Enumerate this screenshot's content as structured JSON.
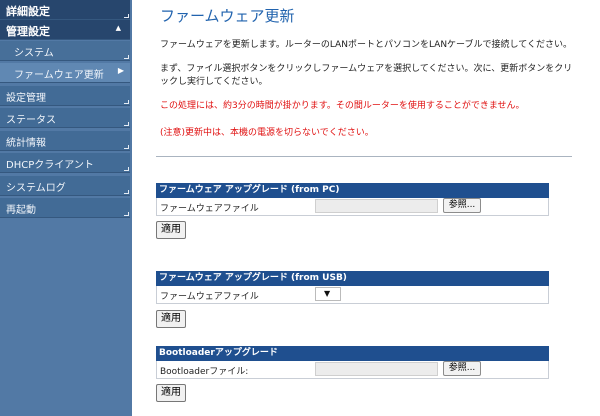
{
  "sidebar": {
    "top": "詳細設定",
    "group": "管理設定",
    "sub": [
      {
        "label": "システム"
      },
      {
        "label": "ファームウェア更新"
      },
      {
        "label": "設定管理"
      },
      {
        "label": "ステータス"
      },
      {
        "label": "統計情報"
      },
      {
        "label": "DHCPクライアント"
      },
      {
        "label": "システムログ"
      },
      {
        "label": "再起動"
      }
    ]
  },
  "main": {
    "title": "ファームウェア更新",
    "desc1": "ファームウェアを更新します。ルーターのLANポートとパソコンをLANケーブルで接続してください。",
    "desc2": "まず、ファイル選択ボタンをクリックしファームウェアを選択してください。次に、更新ボタンをクリックし実行してください。",
    "warn1": "この処理には、約3分の時間が掛かります。その間ルーターを使用することができません。",
    "warn2": "(注意)更新中は、本機の電源を切らないでください。"
  },
  "sections": {
    "pc": {
      "header": "ファームウェア アップグレード (from PC)",
      "label": "ファームウェアファイル",
      "browse": "参照...",
      "apply": "適用"
    },
    "usb": {
      "header": "ファームウェア アップグレード (from USB)",
      "label": "ファームウェアファイル",
      "apply": "適用"
    },
    "boot": {
      "header": "Bootloaderアップグレード",
      "label": "Bootloaderファイル:",
      "browse": "参照...",
      "apply": "適用"
    }
  },
  "colors": {
    "sidebar": "#5279a5",
    "header": "#1f4f8f",
    "title": "#2163ae",
    "warning": "#e01010"
  }
}
